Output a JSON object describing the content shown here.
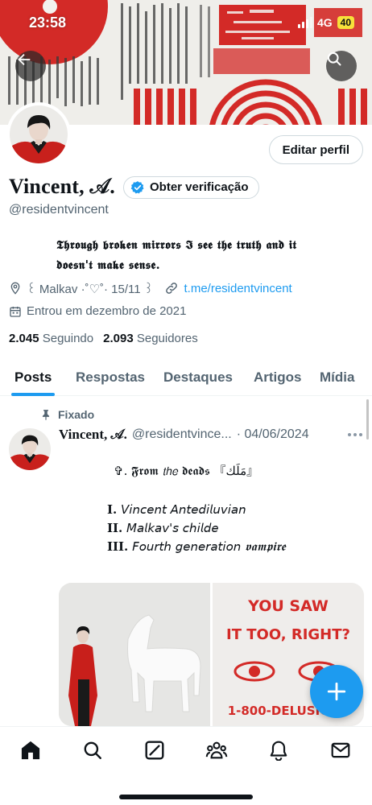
{
  "status_bar": {
    "time": "23:58",
    "network": "4G",
    "battery": "40"
  },
  "profile": {
    "name": "Vincent, 𝒜.",
    "verify_label": "Obter verificação",
    "handle": "@residentvincent",
    "edit_label": "Editar perfil",
    "bio_line1": "𝕿𝖍𝖗𝖔𝖚𝖌𝖍 𝖇𝖗𝖔𝖐𝖊𝖓 𝖒𝖎𝖗𝖗𝖔𝖗𝖘 𝕴 𝖘𝖊𝖊 𝖙𝖍𝖊 𝖙𝖗𝖚𝖙𝖍 𝖆𝖓𝖉 𝖎𝖙",
    "bio_line2": "𝖉𝖔𝖊𝖘𝖓'𝖙 𝖒𝖆𝖐𝖊 𝖘𝖊𝖓𝖘𝖊.",
    "location": "꒰ Malkav ·˚♡˚· 15/11 ꒱",
    "link": "t.me/residentvincent",
    "joined": "Entrou em dezembro de 2021",
    "following_count": "2.045",
    "following_label": "Seguindo",
    "followers_count": "2.093",
    "followers_label": "Seguidores"
  },
  "tabs": [
    {
      "label": "Posts",
      "active": true
    },
    {
      "label": "Respostas",
      "active": false
    },
    {
      "label": "Destaques",
      "active": false
    },
    {
      "label": "Artigos",
      "active": false
    },
    {
      "label": "Mídia",
      "active": false
    }
  ],
  "post": {
    "pinned_label": "Fixado",
    "author": "Vincent, 𝒜.",
    "handle": "@residentvince...",
    "date": "· 04/06/2024",
    "line0": "✞.  𝕱𝖗𝖔𝖒 𝘵𝘩𝘦 𝖉𝖊𝖆𝖉𝖘  『مَلَك』",
    "line1_num": "I.",
    "line1": "𝘝𝘪𝘯𝘤𝘦𝘯𝘵 𝘈𝘯𝘵𝘦𝘥𝘪𝘭𝘶𝘷𝘪𝘢𝘯",
    "line2_num": "II.",
    "line2": "𝘔𝘢𝘭𝘬𝘢𝘷'𝘴 𝘤𝘩𝘪𝘭𝘥𝘦",
    "line3_num": "III.",
    "line3": "𝘍𝘰𝘶𝘳𝘵𝘩 𝘨𝘦𝘯𝘦𝘳𝘢𝘵𝘪𝘰𝘯 𝖛𝖆𝖒𝖕𝖎𝖗𝖊",
    "media2_line1": "YOU SAW",
    "media2_line2": "IT TOO, RIGHT?",
    "media2_line3": "1-800-DELUSIONS"
  },
  "icons": {
    "back": "arrow-left-icon",
    "search": "search-icon",
    "compose": "plus-icon",
    "nav": [
      "home-icon",
      "search-icon",
      "grok-icon",
      "communities-icon",
      "bell-icon",
      "mail-icon"
    ]
  },
  "colors": {
    "accent": "#1d9bf0",
    "text": "#0f1419",
    "secondary": "#536471",
    "banner_red": "#d32a27"
  }
}
